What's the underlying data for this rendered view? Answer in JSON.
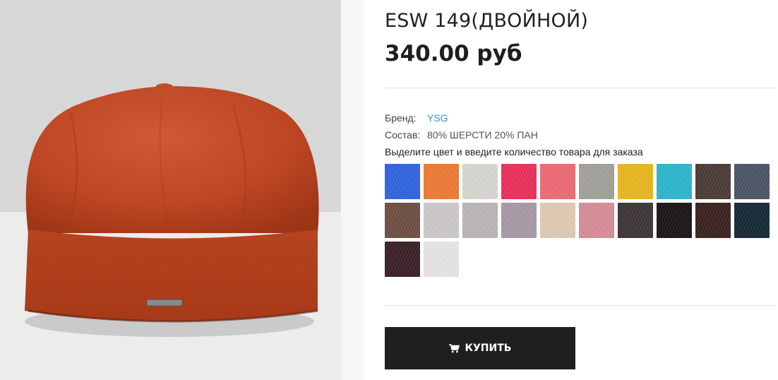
{
  "product": {
    "title": "ESW 149(ДВОЙНОЙ)",
    "price": "340.00 руб"
  },
  "attributes": {
    "brand_label": "Бренд:",
    "brand_value": "YSG",
    "composition_label": "Состав:",
    "composition_value": "80% ШЕРСТИ 20% ПАН"
  },
  "hint": "Выделите цвет и введите количество товара для заказа",
  "swatches": [
    {
      "color": "#2f64e0"
    },
    {
      "color": "#f07a35"
    },
    {
      "color": "#d9d8d2"
    },
    {
      "color": "#ec2f5b"
    },
    {
      "color": "#ef6a75"
    },
    {
      "color": "#a3a19b"
    },
    {
      "color": "#eab81f"
    },
    {
      "color": "#2db7cf"
    },
    {
      "color": "#4b3b37"
    },
    {
      "color": "#4b5565"
    },
    {
      "color": "#6f4f43"
    },
    {
      "color": "#cfcacb"
    },
    {
      "color": "#bcb6b8"
    },
    {
      "color": "#a99ba6"
    },
    {
      "color": "#e1cbb4"
    },
    {
      "color": "#d98d97"
    },
    {
      "color": "#3d3536"
    },
    {
      "color": "#1b1414"
    },
    {
      "color": "#3a221d"
    },
    {
      "color": "#162836"
    },
    {
      "color": "#3a2026"
    },
    {
      "color": "#e9e7e6"
    }
  ],
  "buy_button": {
    "label": "КУПИТЬ",
    "icon": "cart-icon"
  },
  "colors": {
    "link": "#3a8fd6",
    "button_bg": "#1f1f1f"
  }
}
